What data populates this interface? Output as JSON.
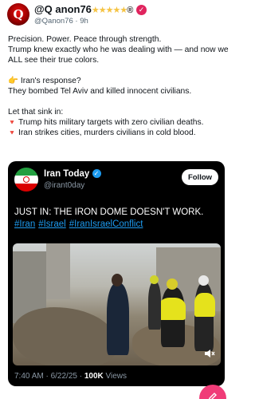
{
  "header": {
    "name": "@Q anon76",
    "stars": "★★★★★",
    "registered": "®",
    "handle": "@Qanon76",
    "time": "9h"
  },
  "post": {
    "line1": "Precision. Power. Peace through strength.",
    "line2": "Trump knew exactly who he was dealing with — and now we ALL see their true colors.",
    "hand_emoji": "👉",
    "question": "Iran's response?",
    "answer": "They bombed Tel Aviv and killed innocent civilians.",
    "sink": "Let that sink in:",
    "bullet_marker": "🔻",
    "bullet1": "Trump hits military targets with zero civilian deaths.",
    "bullet2": "Iran strikes cities, murders civilians in cold blood."
  },
  "embed": {
    "name": "Iran Today",
    "handle": "@irant0day",
    "follow_label": "Follow",
    "text": "JUST IN: THE IRON DOME DOESN'T WORK.",
    "hashtags": [
      "#Iran",
      "#Israel",
      "#IranIsraelConflict"
    ],
    "time": "7:40 AM · 6/22/25 · ",
    "views_count": "100K",
    "views_label": " Views",
    "mute_icon": "speaker-muted-icon"
  },
  "fab": {
    "icon": "compose-icon"
  },
  "colors": {
    "verified": "#e0245e",
    "embed_verified": "#1d9bf0",
    "fab": "#f03c78",
    "bullet": "#e0245e"
  }
}
